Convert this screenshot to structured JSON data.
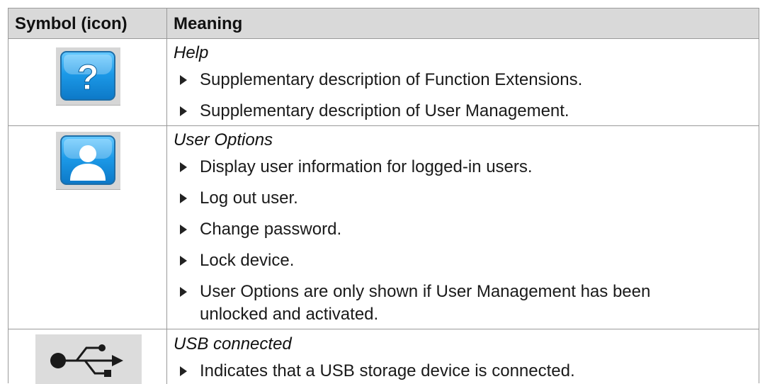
{
  "header": {
    "col_symbol": "Symbol (icon)",
    "col_meaning": "Meaning"
  },
  "rows": [
    {
      "icon": "help-question-icon",
      "title": "Help",
      "bullets": [
        "Supplementary description of Function Extensions.",
        "Supplementary description of User Management."
      ]
    },
    {
      "icon": "user-options-icon",
      "title": "User Options",
      "bullets": [
        "Display user information for logged-in users.",
        "Log out user.",
        "Change password.",
        "Lock device.",
        "User Options are only shown if User Management has been",
        "unlocked and activated."
      ]
    },
    {
      "icon": "usb-icon",
      "title": "USB connected",
      "bullets": [
        "Indicates that a USB storage device is connected."
      ]
    }
  ],
  "colors": {
    "header_bg": "#d9d9d9",
    "border": "#9a9a9a",
    "icon_blue": "#1c9ae8"
  }
}
